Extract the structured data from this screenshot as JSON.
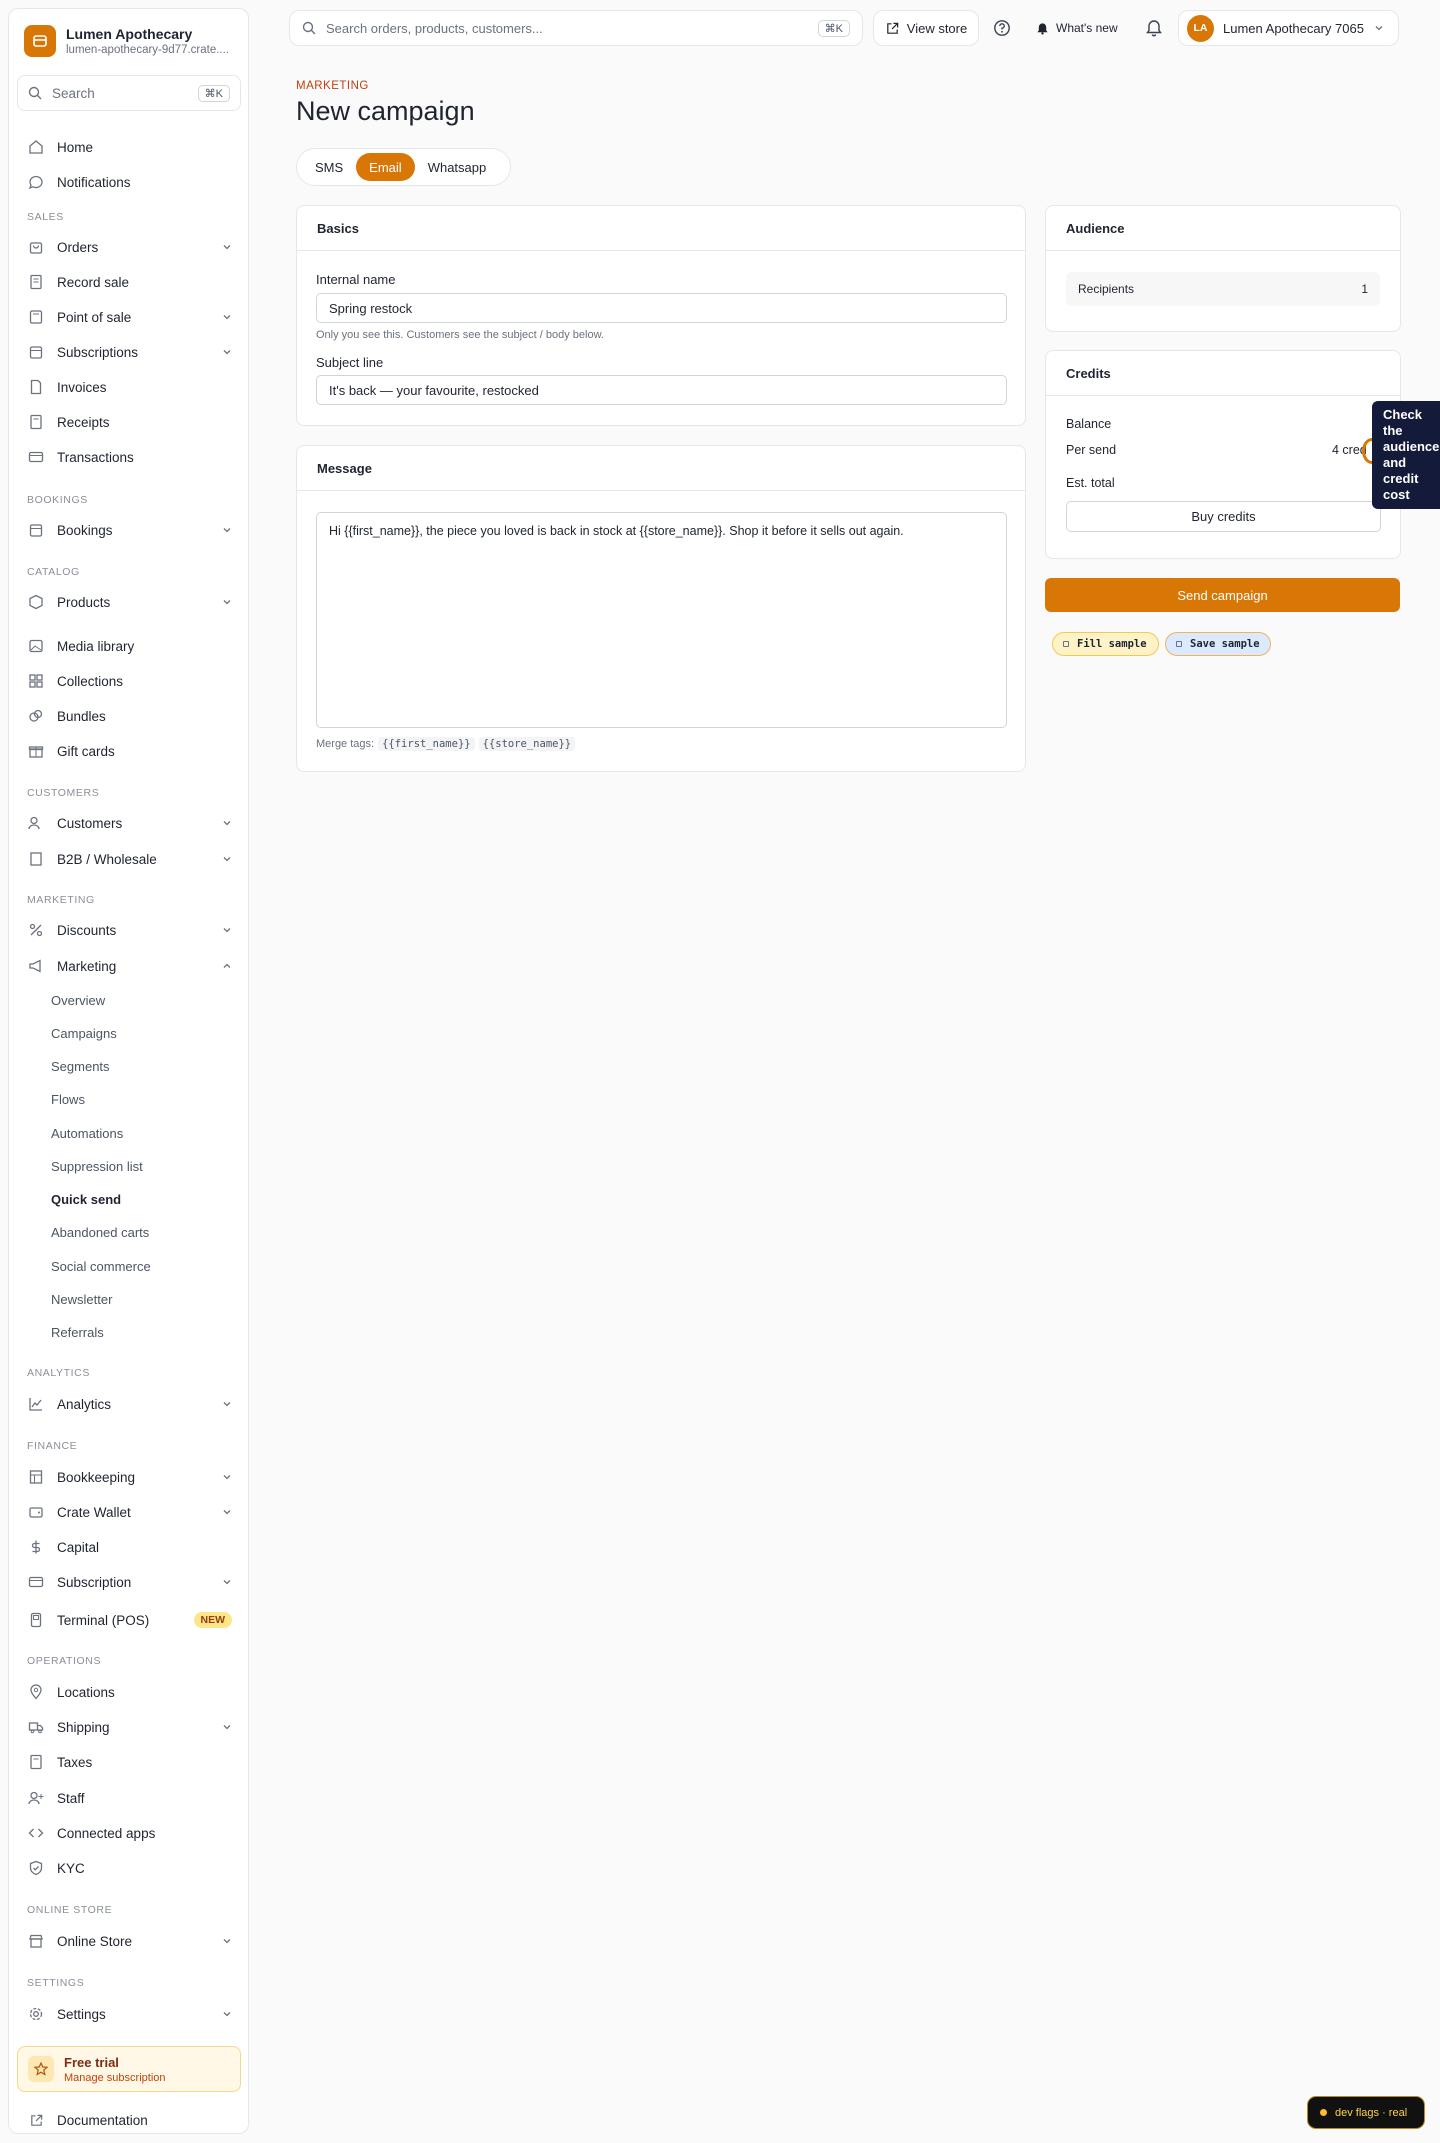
{
  "sidebar": {
    "brand_name": "Lumen Apothecary",
    "brand_url": "lumen-apothecary-9d77.crate....",
    "search_placeholder": "Search",
    "search_kbd": "⌘K",
    "home": "Home",
    "notifications": "Notifications",
    "sections": {
      "sales": "SALES",
      "bookings": "BOOKINGS",
      "catalog": "CATALOG",
      "customers": "CUSTOMERS",
      "marketing": "MARKETING",
      "analytics": "ANALYTICS",
      "finance": "FINANCE",
      "operations": "OPERATIONS",
      "online_store": "ONLINE STORE",
      "settings": "SETTINGS"
    },
    "items": {
      "orders": "Orders",
      "record_sale": "Record sale",
      "point_of_sale": "Point of sale",
      "subscriptions": "Subscriptions",
      "invoices": "Invoices",
      "receipts": "Receipts",
      "transactions": "Transactions",
      "bookings": "Bookings",
      "products": "Products",
      "media_library": "Media library",
      "collections": "Collections",
      "bundles": "Bundles",
      "gift_cards": "Gift cards",
      "customers": "Customers",
      "b2b": "B2B / Wholesale",
      "discounts": "Discounts",
      "marketing": "Marketing",
      "analytics": "Analytics",
      "bookkeeping": "Bookkeeping",
      "crate_wallet": "Crate Wallet",
      "capital": "Capital",
      "subscription": "Subscription",
      "terminal": "Terminal (POS)",
      "locations": "Locations",
      "shipping": "Shipping",
      "taxes": "Taxes",
      "staff": "Staff",
      "connected_apps": "Connected apps",
      "kyc": "KYC",
      "online_store": "Online Store",
      "settings": "Settings"
    },
    "new_badge": "NEW",
    "marketing_sub": [
      "Overview",
      "Campaigns",
      "Segments",
      "Flows",
      "Automations",
      "Suppression list",
      "Quick send",
      "Abandoned carts",
      "Social commerce",
      "Newsletter",
      "Referrals"
    ],
    "trial_title": "Free trial",
    "trial_sub": "Manage subscription",
    "documentation": "Documentation"
  },
  "topbar": {
    "search_placeholder": "Search orders, products, customers...",
    "search_kbd": "⌘K",
    "view_store": "View store",
    "whats_new": "What's new",
    "avatar_initials": "LA",
    "account_name": "Lumen Apothecary 7065"
  },
  "page": {
    "eyebrow": "MARKETING",
    "title": "New campaign",
    "tabs": [
      "SMS",
      "Email",
      "Whatsapp"
    ],
    "active_tab": "Email"
  },
  "basics": {
    "heading": "Basics",
    "internal_name_label": "Internal name",
    "internal_name_value": "Spring restock",
    "internal_name_hint": "Only you see this. Customers see the subject / body below.",
    "subject_label": "Subject line",
    "subject_value": "It's back — your favourite, restocked"
  },
  "message": {
    "heading": "Message",
    "body": "Hi {{first_name}}, the piece you loved is back in stock at {{store_name}}. Shop it before it sells out again.",
    "merge_label": "Merge tags:",
    "merge_tags": [
      "{{first_name}}",
      "{{store_name}}"
    ]
  },
  "audience": {
    "heading": "Audience",
    "recipients_label": "Recipients",
    "recipients_value": "1"
  },
  "credits": {
    "heading": "Credits",
    "balance_label": "Balance",
    "per_send_label": "Per send",
    "per_send_value": "4 cred",
    "est_total_label": "Est. total",
    "buy_label": "Buy credits"
  },
  "actions": {
    "send_label": "Send campaign",
    "fill_sample": "Fill sample",
    "save_sample": "Save sample"
  },
  "tooltip": "Check the audience and credit cost",
  "devflags": "dev flags · real",
  "colors": {
    "accent": "#d97706",
    "tooltip_bg": "#131a3a"
  }
}
